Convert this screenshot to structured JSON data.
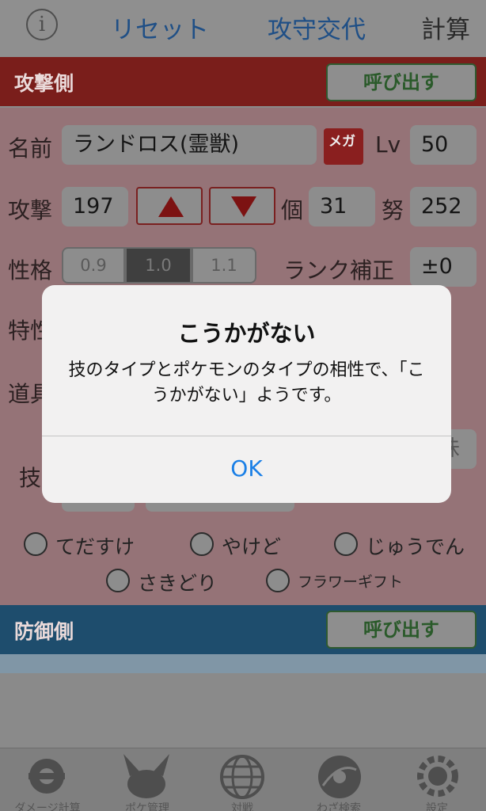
{
  "toolbar": {
    "info_label": "i",
    "reset_label": "リセット",
    "swap_label": "攻守交代",
    "calc_label": "計算"
  },
  "attack": {
    "header": "攻撃側",
    "call_label": "呼び出す",
    "name_label": "名前",
    "name_value": "ランドロス(霊獣)",
    "mega_label": "メガ",
    "lv_label": "Lv",
    "lv_value": "50",
    "stat_label": "攻撃",
    "stat_value": "197",
    "iv_label": "個",
    "iv_value": "31",
    "ev_label": "努",
    "ev_value": "252",
    "nature_label": "性格",
    "nature_options": [
      "0.9",
      "1.0",
      "1.1"
    ],
    "nature_selected": "1.0",
    "rank_label": "ランク補正",
    "rank_value": "±0",
    "ability_label_partial": "特性",
    "item_label_partial": "道具",
    "move_label_partial": "技",
    "right_partial": "味",
    "options": [
      "てだすけ",
      "やけど",
      "じゅうでん",
      "さきどり",
      "フラワーギフト"
    ]
  },
  "defense": {
    "header": "防御側",
    "call_label": "呼び出す"
  },
  "tabs": [
    {
      "label": "ダメージ計算",
      "icon": "damage-calc-icon"
    },
    {
      "label": "ポケ管理",
      "icon": "pokemon-manage-icon"
    },
    {
      "label": "対戦",
      "icon": "globe-icon"
    },
    {
      "label": "わざ検索",
      "icon": "disc-icon"
    },
    {
      "label": "設定",
      "icon": "gear-icon"
    }
  ],
  "alert": {
    "title": "こうかがない",
    "message": "技のタイプとポケモンのタイプの相性で、「こうかがない」ようです。",
    "ok_label": "OK"
  },
  "colors": {
    "attack_header": "#c0302c",
    "defense_header": "#2a6fa0",
    "alert_button": "#1a7fe6"
  }
}
